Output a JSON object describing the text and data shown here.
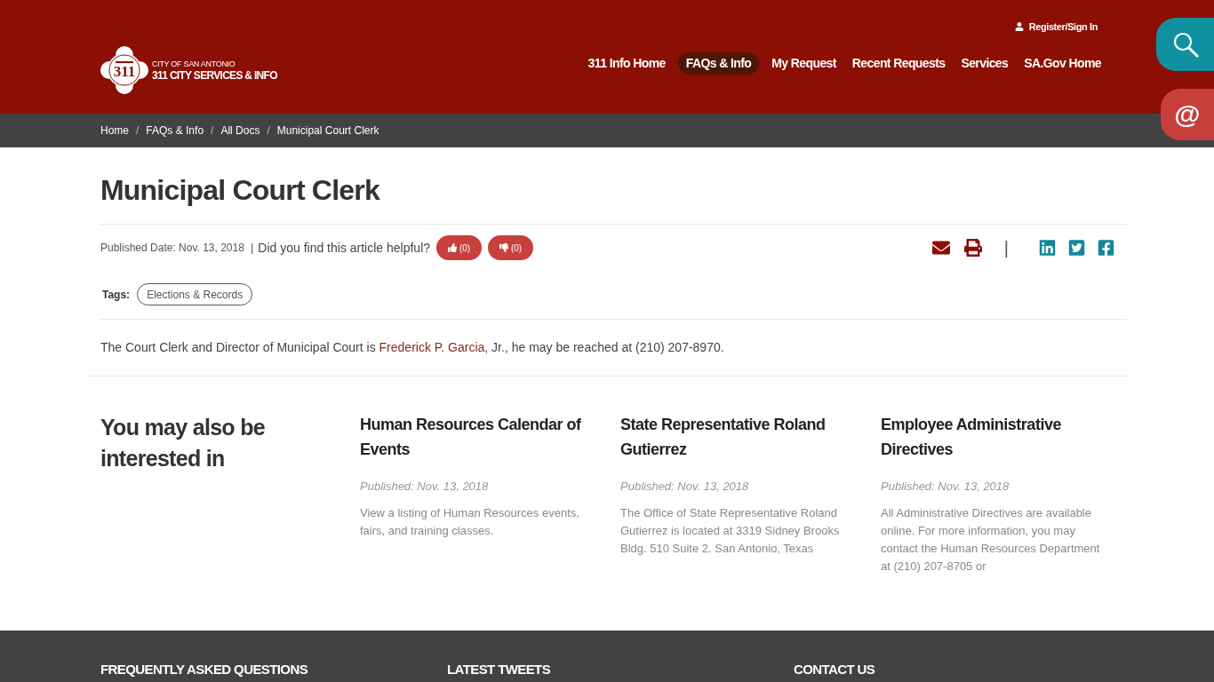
{
  "header": {
    "logo": {
      "badge": "311",
      "line_1": "CITY OF SAN ANTONIO",
      "line_2": "311 CITY SERVICES & INFO"
    },
    "account_link": "Register/Sign In",
    "nav": [
      {
        "label": "311 Info Home",
        "selected": false
      },
      {
        "label": "FAQs & Info",
        "selected": true
      },
      {
        "label": "My Request",
        "selected": false
      },
      {
        "label": "Recent Requests",
        "selected": false
      },
      {
        "label": "Services",
        "selected": false
      },
      {
        "label": "SA.Gov Home",
        "selected": false
      }
    ]
  },
  "side_buttons": [
    {
      "kind": "search"
    },
    {
      "kind": "email",
      "label": "@"
    }
  ],
  "breadcrumb": {
    "separator": "/",
    "items": [
      "Home",
      "FAQs & Info",
      "All Docs",
      "Municipal Court Clerk"
    ]
  },
  "article": {
    "title": "Municipal Court Clerk",
    "published_date": "Published Date: Nov. 13, 2018",
    "divider": "|",
    "helpful_prompt": "Did you find this article helpful?",
    "votes": [
      {
        "kind": "up",
        "count": "(0)"
      },
      {
        "kind": "down",
        "count": "(0)"
      }
    ],
    "share": {
      "actions": [
        {
          "kind": "email"
        },
        {
          "kind": "print"
        }
      ],
      "separator": "|",
      "social": [
        {
          "kind": "linkedin"
        },
        {
          "kind": "twitter"
        },
        {
          "kind": "facebook"
        }
      ]
    },
    "tags_label": "Tags:",
    "tags": [
      "Elections & Records"
    ],
    "body": {
      "before": "The Court Clerk and Director of Municipal Court is ",
      "link": "Frederick P. Garcia",
      "after": ", Jr., he may be reached at (210) 207-8970."
    }
  },
  "related": {
    "heading": "You may also be interested in",
    "items": [
      {
        "title": "Human Resources Calendar of Events",
        "published": "Published: Nov. 13, 2018",
        "description": "View a listing of Human Resources events, fairs, and training classes."
      },
      {
        "title": "State Representative Roland Gutierrez",
        "published": "Published: Nov. 13, 2018",
        "description": "The Office of State Representative Roland Gutierrez is located at 3319 Sidney Brooks Bldg. 510 Suite 2. San Antonio, Texas"
      },
      {
        "title": "Employee Administrative Directives",
        "published": "Published: Nov. 13, 2018",
        "description": "All Administrative Directives are available online. For more information, you may contact the Human Resources Department at (210) 207-8705 or"
      }
    ]
  },
  "footer": {
    "headings": [
      "FREQUENTLY ASKED QUESTIONS",
      "LATEST TWEETS",
      "CONTACT US"
    ]
  }
}
